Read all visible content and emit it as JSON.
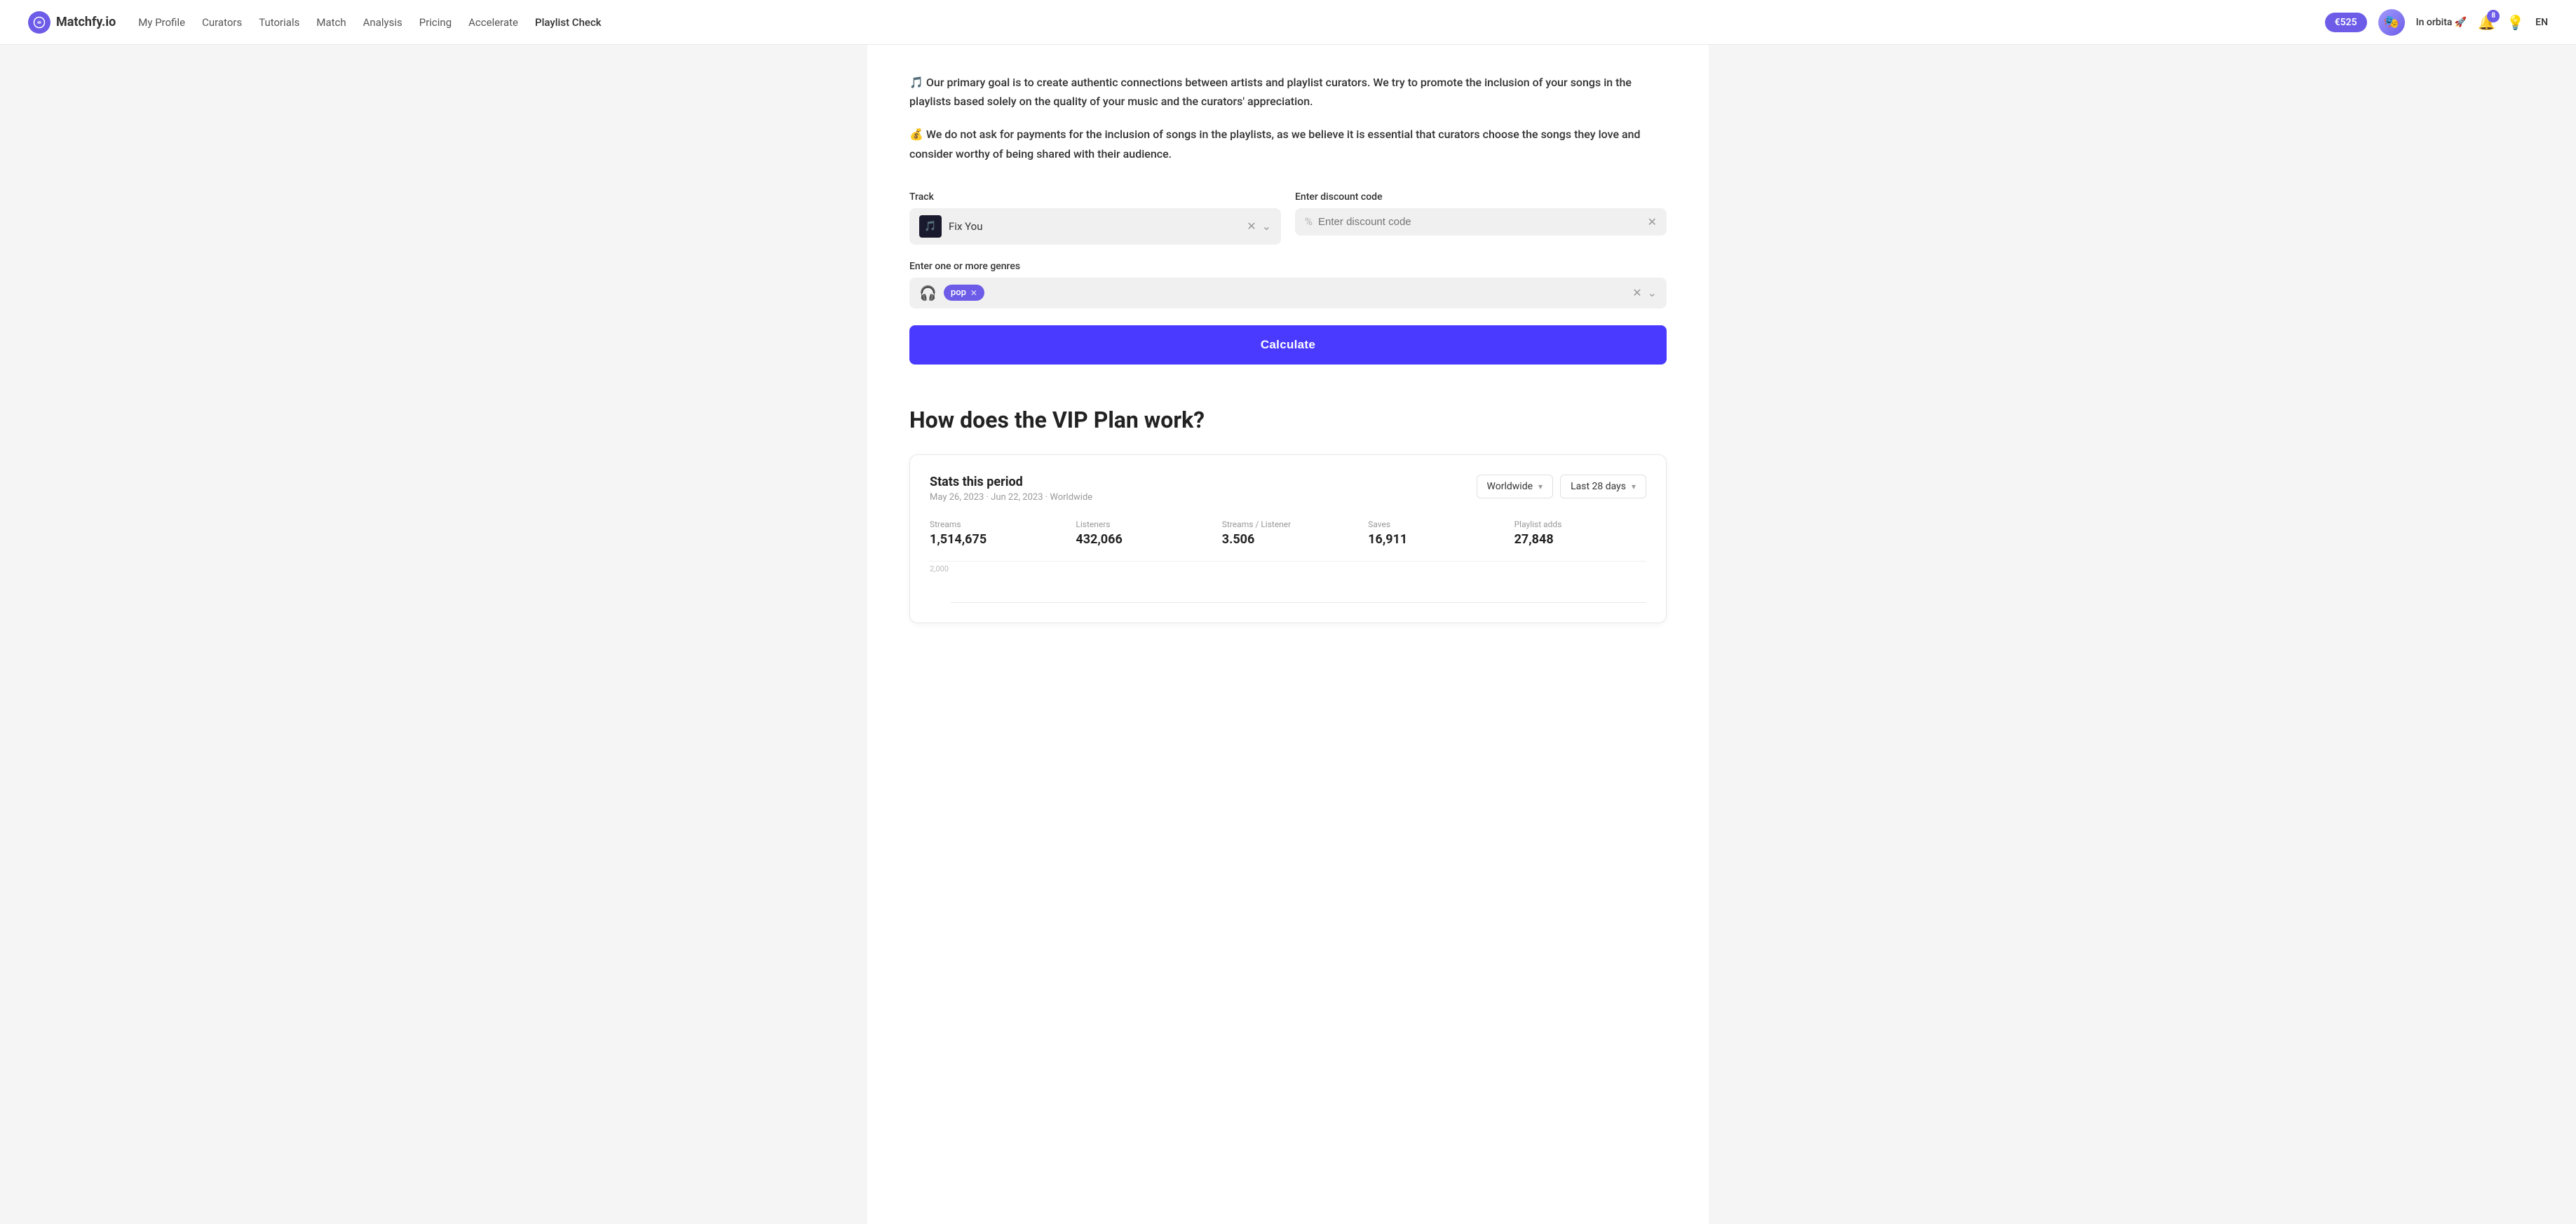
{
  "navbar": {
    "logo_text": "Matchfy.io",
    "logo_icon": "🎵",
    "links": [
      {
        "label": "My Profile",
        "active": false
      },
      {
        "label": "Curators",
        "active": false
      },
      {
        "label": "Tutorials",
        "active": false
      },
      {
        "label": "Match",
        "active": false
      },
      {
        "label": "Analysis",
        "active": false
      },
      {
        "label": "Pricing",
        "active": false
      },
      {
        "label": "Accelerate",
        "active": false
      },
      {
        "label": "Playlist Check",
        "active": true
      }
    ],
    "balance": "€525",
    "user_name": "In orbita 🚀",
    "notif_count": "8",
    "lang": "EN"
  },
  "intro": {
    "text1": "🎵 Our primary goal is to create authentic connections between artists and playlist curators. We try to promote the inclusion of your songs in the playlists based solely on the quality of your music and the curators' appreciation.",
    "text2": "💰 We do not ask for payments for the inclusion of songs in the playlists, as we believe it is essential that curators choose the songs they love and consider worthy of being shared with their audience."
  },
  "form": {
    "track_label": "Track",
    "track_name": "Fix You",
    "track_emoji": "🎵",
    "discount_label": "Enter discount code",
    "discount_placeholder": "Enter discount code",
    "genre_label": "Enter one or more genres",
    "genres": [
      {
        "label": "pop"
      }
    ],
    "calculate_label": "Calculate"
  },
  "vip": {
    "title": "How does the VIP Plan work?",
    "stats_card": {
      "title": "Stats this period",
      "subtitle": "May 26, 2023 · Jun 22, 2023 · Worldwide",
      "filter_geo": "Worldwide",
      "filter_time": "Last 28 days",
      "metrics": [
        {
          "label": "Streams",
          "value": "1,514,675"
        },
        {
          "label": "Listeners",
          "value": "432,066"
        },
        {
          "label": "Streams / Listener",
          "value": "3.506"
        },
        {
          "label": "Saves",
          "value": "16,911"
        },
        {
          "label": "Playlist adds",
          "value": "27,848"
        }
      ],
      "chart_label": "2,000"
    }
  }
}
